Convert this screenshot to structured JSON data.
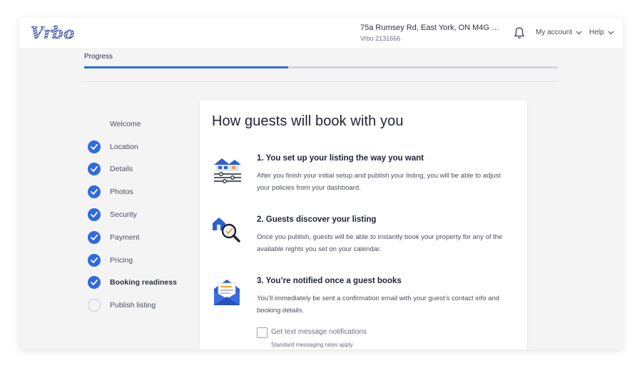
{
  "brand": {
    "logo_text": "Vrbo",
    "color": "#3d50a8"
  },
  "header": {
    "address": "75a Rumsey Rd, East York, ON M4G 1N...",
    "listing_id": "Vrbo 2131666",
    "my_account_label": "My account",
    "help_label": "Help",
    "icons": [
      "bell-icon",
      "chevron-down-icon"
    ]
  },
  "progress": {
    "label": "Progress",
    "fraction": 0.43,
    "accent": "#2f6adf"
  },
  "steps": [
    {
      "label": "Welcome",
      "status": "none"
    },
    {
      "label": "Location",
      "status": "done"
    },
    {
      "label": "Details",
      "status": "done"
    },
    {
      "label": "Photos",
      "status": "done"
    },
    {
      "label": "Security",
      "status": "done"
    },
    {
      "label": "Payment",
      "status": "done"
    },
    {
      "label": "Pricing",
      "status": "done"
    },
    {
      "label": "Booking readiness",
      "status": "current"
    },
    {
      "label": "Publish listing",
      "status": "todo"
    }
  ],
  "main": {
    "title": "How guests will book with you",
    "items": [
      {
        "icon": "house-settings-icon",
        "heading": "1. You set up your listing the way you want",
        "text": "After you finish your initial setup and publish your listing, you will be able to adjust your policies from your dashboard."
      },
      {
        "icon": "house-magnifier-icon",
        "heading": "2. Guests discover your listing",
        "text": "Once you publish, guests will be able to instantly book your property for any of the available nights you set on your calendar."
      },
      {
        "icon": "envelope-icon",
        "heading": "3. You’re notified once a guest books",
        "text": "You’ll immediately be sent a confirmation email with your guest’s contact info and booking details."
      }
    ],
    "sms": {
      "label": "Get text message notifications",
      "note": "Standard messaging rates apply",
      "checked": false
    }
  }
}
